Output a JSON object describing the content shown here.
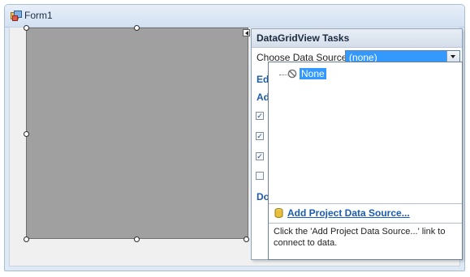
{
  "form": {
    "title": "Form1"
  },
  "tasks_panel": {
    "title": "DataGridView Tasks",
    "choose_label": "Choose Data Source",
    "selected_value": "(none)",
    "partial_items": [
      "Edi",
      "Ad",
      "Do"
    ]
  },
  "dropdown": {
    "none_item": "None",
    "add_link": "Add Project Data Source...",
    "help_text": "Click the 'Add Project Data Source...' link to connect to data."
  },
  "colors": {
    "selection_blue": "#3399ff",
    "link_blue": "#1a5bb3",
    "grid_gray": "#a0a0a0"
  },
  "icons": {
    "form_icon": "form-icon",
    "none_icon": "prohibited-icon",
    "data_source_icon": "database-icon",
    "dropdown_arrow": "chevron-down-icon",
    "smart_tag": "smart-tag-arrow-icon"
  }
}
